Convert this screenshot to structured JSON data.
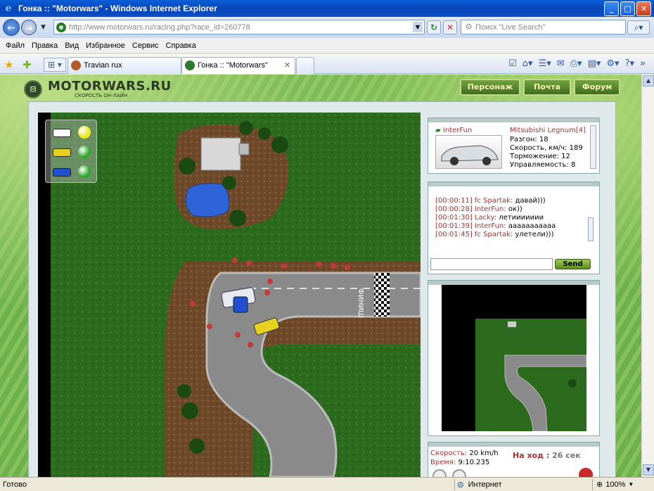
{
  "window": {
    "title": "Гонка :: \"Motorwars\" - Windows Internet Explorer",
    "icon": "ie-icon",
    "buttons": [
      "minimize",
      "maximize",
      "close"
    ]
  },
  "addressbar": {
    "url_gray": "http://www.motorwars.ru",
    "url_dark": "/racing.php?race_id=260778",
    "search_placeholder": "Поиск \"Live Search\""
  },
  "menu": [
    "Файл",
    "Правка",
    "Вид",
    "Избранное",
    "Сервис",
    "Справка"
  ],
  "tabs": [
    {
      "label": "Travian rux",
      "active": false
    },
    {
      "label": "Гонка :: \"Motorwars\"",
      "active": true
    }
  ],
  "site": {
    "logo_name": "MOTORWARS.RU",
    "slogan": "СКОРОСТЬ ОН-ЛАЙН",
    "nav": [
      "Персонаж",
      "Почта",
      "Форум"
    ]
  },
  "player": {
    "name": "InterFun",
    "car": "Mitsubishi Legnum[4]",
    "stats": [
      "Разгон: 18",
      "Скорость, км/ч: 189",
      "Торможение: 12",
      "Управляемость: 8"
    ]
  },
  "chat": [
    {
      "time": "[00:00:11]",
      "nick": "fc Spartak:",
      "msg": "давай)))"
    },
    {
      "time": "[00:00:28]",
      "nick": "InterFun:",
      "msg": "ок))"
    },
    {
      "time": "[00:01:30]",
      "nick": "Lacky:",
      "msg": "летиииииии"
    },
    {
      "time": "[00:01:39]",
      "nick": "InterFun:",
      "msg": "ааааааааааа"
    },
    {
      "time": "[00:01:45]",
      "nick": "fc Spartak:",
      "msg": "улетели)))"
    }
  ],
  "send_label": "Send",
  "race": {
    "speed_label": "Скорость:",
    "speed_value": "20 km/h",
    "time_label": "Время:",
    "time_value": "9:10.235",
    "turn_label": "На ход :",
    "turn_value": "26 сек"
  },
  "finish_text": "ФИНИШ",
  "legend": [
    {
      "car_color": "#ffffff",
      "status_color": "#e8e820"
    },
    {
      "car_color": "#e6d21e",
      "status_color": "#2aa82a"
    },
    {
      "car_color": "#2050d0",
      "status_color": "#2aa82a"
    }
  ],
  "status": {
    "ready": "Готово",
    "zone": "Интернет",
    "zoom": "100%"
  }
}
